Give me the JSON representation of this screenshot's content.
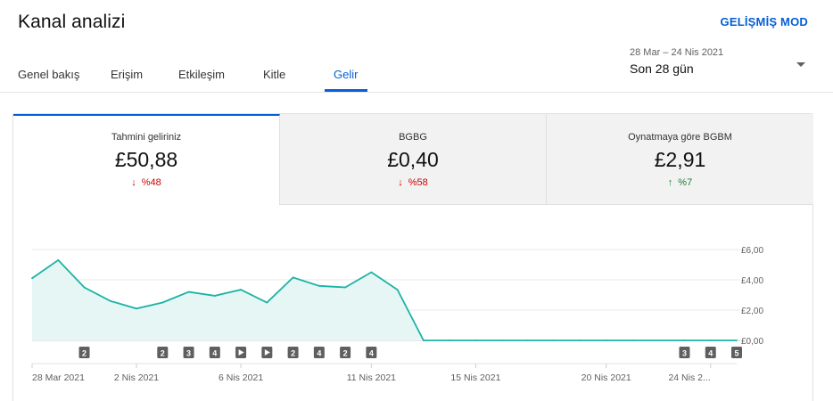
{
  "header": {
    "title": "Kanal analizi",
    "advanced_mode": "GELİŞMİŞ MOD"
  },
  "tabs": [
    {
      "label": "Genel bakış",
      "active": false
    },
    {
      "label": "Erişim",
      "active": false
    },
    {
      "label": "Etkileşim",
      "active": false
    },
    {
      "label": "Kitle",
      "active": false
    },
    {
      "label": "Gelir",
      "active": true
    }
  ],
  "date_picker": {
    "range": "28 Mar – 24 Nis 2021",
    "label": "Son 28 gün",
    "icon": "caret-down-icon"
  },
  "metrics": [
    {
      "label": "Tahmini geliriniz",
      "value": "£50,88",
      "change": "%48",
      "direction": "down",
      "active": true
    },
    {
      "label": "BGBG",
      "value": "£0,40",
      "change": "%58",
      "direction": "down",
      "active": false
    },
    {
      "label": "Oynatmaya göre BGBM",
      "value": "£2,91",
      "change": "%7",
      "direction": "up",
      "active": false
    }
  ],
  "colors": {
    "accent": "#065fd4",
    "line": "#1ab3a6",
    "area": "#e6f6f4",
    "down": "#cc0000",
    "up": "#188038"
  },
  "chart_data": {
    "type": "area",
    "x": [
      "28 Mar",
      "29 Mar",
      "30 Mar",
      "31 Mar",
      "1 Nis",
      "2 Nis",
      "3 Nis",
      "4 Nis",
      "5 Nis",
      "6 Nis",
      "7 Nis",
      "8 Nis",
      "9 Nis",
      "10 Nis",
      "11 Nis",
      "12 Nis",
      "13 Nis",
      "14 Nis",
      "15 Nis",
      "16 Nis",
      "17 Nis",
      "18 Nis",
      "19 Nis",
      "20 Nis",
      "21 Nis",
      "22 Nis",
      "23 Nis",
      "24 Nis"
    ],
    "values": [
      4.1,
      5.3,
      3.5,
      2.6,
      2.1,
      2.5,
      3.2,
      2.95,
      3.35,
      2.5,
      4.15,
      3.6,
      3.5,
      4.5,
      3.35,
      0,
      0,
      0,
      0,
      0,
      0,
      0,
      0,
      0,
      0,
      0,
      0,
      0
    ],
    "ylim": [
      0,
      6
    ],
    "yticks": [
      "£0,00",
      "£2,00",
      "£4,00",
      "£6,00"
    ],
    "ytick_values": [
      0,
      2,
      4,
      6
    ],
    "xtick_labels": [
      "28 Mar 2021",
      "2 Nis 2021",
      "6 Nis 2021",
      "11 Nis 2021",
      "15 Nis 2021",
      "20 Nis 2021",
      "24 Nis 2..."
    ],
    "xtick_indices": [
      0,
      4,
      8,
      13,
      17,
      22,
      26
    ],
    "grid": true,
    "markers": [
      {
        "index": 2,
        "label": "2"
      },
      {
        "index": 5,
        "label": "2"
      },
      {
        "index": 6,
        "label": "3"
      },
      {
        "index": 7,
        "label": "4"
      },
      {
        "index": 8,
        "label": "play"
      },
      {
        "index": 9,
        "label": "play"
      },
      {
        "index": 10,
        "label": "2"
      },
      {
        "index": 11,
        "label": "4"
      },
      {
        "index": 12,
        "label": "2"
      },
      {
        "index": 13,
        "label": "4"
      },
      {
        "index": 25,
        "label": "3"
      },
      {
        "index": 26,
        "label": "4"
      },
      {
        "index": 27,
        "label": "5"
      }
    ]
  }
}
